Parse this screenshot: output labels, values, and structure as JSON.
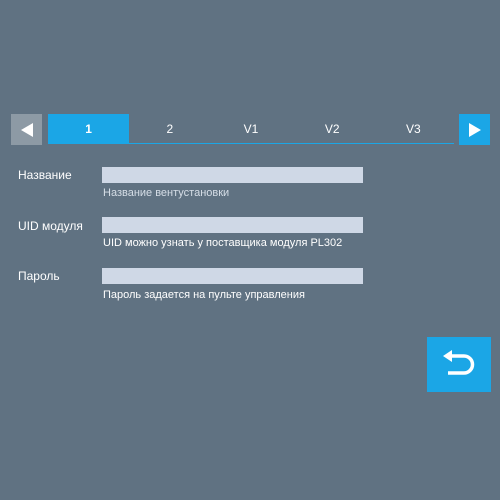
{
  "nav": {
    "prev_icon": "triangle-left-icon",
    "next_icon": "triangle-right-icon",
    "tabs": [
      {
        "label": "1",
        "active": true
      },
      {
        "label": "2",
        "active": false
      },
      {
        "label": "V1",
        "active": false
      },
      {
        "label": "V2",
        "active": false
      },
      {
        "label": "V3",
        "active": false
      }
    ]
  },
  "form": {
    "name": {
      "label": "Название",
      "value": "",
      "placeholder": "",
      "hint": "Название вентустановки"
    },
    "uid": {
      "label": "UID модуля",
      "value": "",
      "placeholder": "",
      "hint": "UID можно узнать у поставщика модуля PL302"
    },
    "password": {
      "label": "Пароль",
      "value": "",
      "placeholder": "",
      "hint": "Пароль задается на пульте управления"
    }
  },
  "actions": {
    "back_icon": "undo-arrow-icon"
  },
  "colors": {
    "background": "#607282",
    "accent": "#1ba6e6",
    "input_bg": "#cfd8e6",
    "nav_disabled": "#8d9aa5"
  }
}
